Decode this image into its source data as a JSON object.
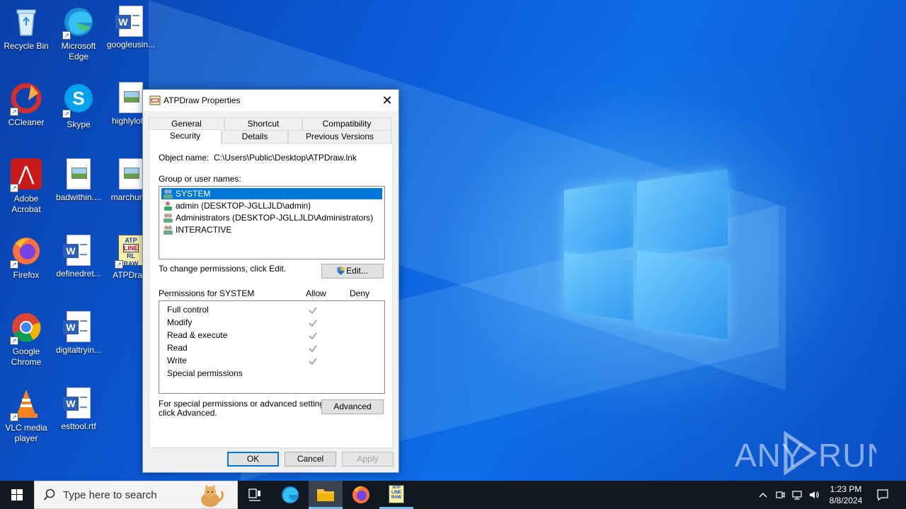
{
  "desktop": {
    "icons": [
      {
        "label": "Recycle Bin"
      },
      {
        "label": "Microsoft Edge"
      },
      {
        "label": "googleusin..."
      },
      {
        "label": "CCleaner"
      },
      {
        "label": "Skype"
      },
      {
        "label": "highlylot..."
      },
      {
        "label": "Adobe Acrobat"
      },
      {
        "label": "badwithin...."
      },
      {
        "label": "marchun..."
      },
      {
        "label": "Firefox"
      },
      {
        "label": "definedret..."
      },
      {
        "label": "ATPDra..."
      },
      {
        "label": "Google Chrome"
      },
      {
        "label": "digitaltryin..."
      },
      {
        "label": "VLC media player"
      },
      {
        "label": "esttool.rtf"
      }
    ],
    "watermark": "ANY RUN"
  },
  "dialog": {
    "title": "ATPDraw Properties",
    "tabs_row1": [
      "General",
      "Shortcut",
      "Compatibility"
    ],
    "tabs_row2": [
      "Security",
      "Details",
      "Previous Versions"
    ],
    "selected_tab": "Security",
    "object_name_label": "Object name:",
    "object_name_value": "C:\\Users\\Public\\Desktop\\ATPDraw.lnk",
    "group_label": "Group or user names:",
    "users": [
      "SYSTEM",
      "admin (DESKTOP-JGLLJLD\\admin)",
      "Administrators (DESKTOP-JGLLJLD\\Administrators)",
      "INTERACTIVE"
    ],
    "change_hint": "To change permissions, click Edit.",
    "edit_button": "Edit...",
    "perm_header": "Permissions for SYSTEM",
    "allow_header": "Allow",
    "deny_header": "Deny",
    "permissions": [
      {
        "name": "Full control",
        "allow": true
      },
      {
        "name": "Modify",
        "allow": true
      },
      {
        "name": "Read & execute",
        "allow": true
      },
      {
        "name": "Read",
        "allow": true
      },
      {
        "name": "Write",
        "allow": true
      },
      {
        "name": "Special permissions",
        "allow": false
      }
    ],
    "advanced_hint_1": "For special permissions or advanced settings,",
    "advanced_hint_2": "click Advanced.",
    "advanced_button": "Advanced",
    "ok_button": "OK",
    "cancel_button": "Cancel",
    "apply_button": "Apply"
  },
  "taskbar": {
    "search_placeholder": "Type here to search",
    "time": "1:23 PM",
    "date": "8/8/2024"
  },
  "colors": {
    "selection": "#0078d7",
    "taskbar": "#101820",
    "wallpaper": "#0b5ad6"
  }
}
